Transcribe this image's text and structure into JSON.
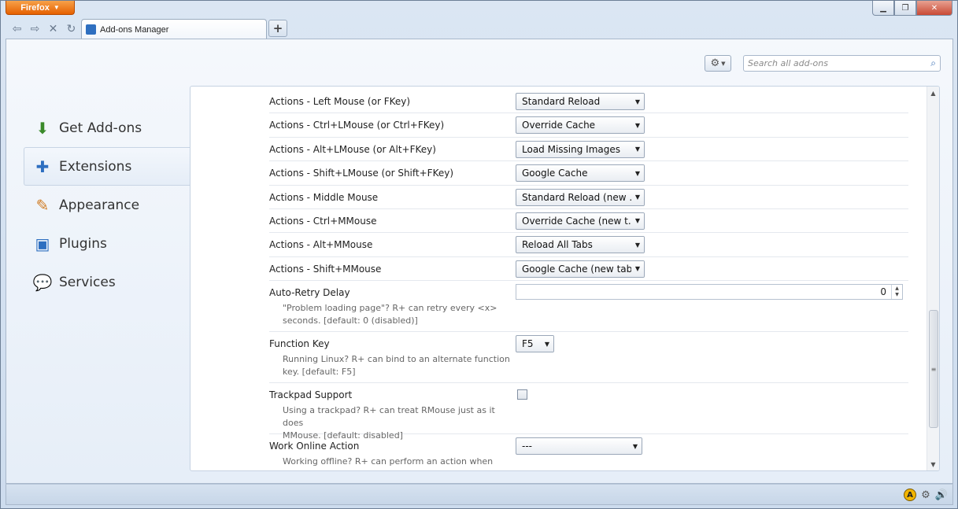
{
  "browser": {
    "menu_button": "Firefox",
    "tab_title": "Add-ons Manager",
    "new_tab_label": "+"
  },
  "toolbar": {
    "search_placeholder": "Search all add-ons"
  },
  "categories": [
    {
      "label": "Get Add-ons",
      "icon": "download-icon",
      "selected": false
    },
    {
      "label": "Extensions",
      "icon": "puzzle-icon",
      "selected": true
    },
    {
      "label": "Appearance",
      "icon": "paintbrush-icon",
      "selected": false
    },
    {
      "label": "Plugins",
      "icon": "plugin-icon",
      "selected": false
    },
    {
      "label": "Services",
      "icon": "chat-bubble-icon",
      "selected": false
    }
  ],
  "settings": [
    {
      "label": "Actions - Left Mouse (or FKey)",
      "value": "Standard Reload"
    },
    {
      "label": "Actions - Ctrl+LMouse (or Ctrl+FKey)",
      "value": "Override Cache"
    },
    {
      "label": "Actions - Alt+LMouse (or Alt+FKey)",
      "value": "Load Missing Images"
    },
    {
      "label": "Actions - Shift+LMouse (or Shift+FKey)",
      "value": "Google Cache"
    },
    {
      "label": "Actions - Middle Mouse",
      "value": "Standard Reload (new ..."
    },
    {
      "label": "Actions - Ctrl+MMouse",
      "value": "Override Cache (new t..."
    },
    {
      "label": "Actions - Alt+MMouse",
      "value": "Reload All Tabs"
    },
    {
      "label": "Actions - Shift+MMouse",
      "value": "Google Cache (new tab)"
    }
  ],
  "auto_retry": {
    "label": "Auto-Retry Delay",
    "desc_line1": "\"Problem loading page\"? R+ can retry every <x>",
    "desc_line2": "seconds. [default: 0 (disabled)]",
    "value": "0"
  },
  "function_key": {
    "label": "Function Key",
    "desc_line1": "Running Linux? R+ can bind to an alternate function",
    "desc_line2": "key. [default: F5]",
    "value": "F5"
  },
  "trackpad": {
    "label": "Trackpad Support",
    "desc_line1": "Using a trackpad? R+ can treat RMouse just as it does",
    "desc_line2": "MMouse. [default: disabled]",
    "checked": false
  },
  "work_online": {
    "label": "Work Online Action",
    "desc_line1": "Working offline? R+ can perform an action when you",
    "value": "---"
  },
  "colors": {
    "firefox_orange": "#e66000",
    "accent_blue": "#2e6fc0"
  }
}
